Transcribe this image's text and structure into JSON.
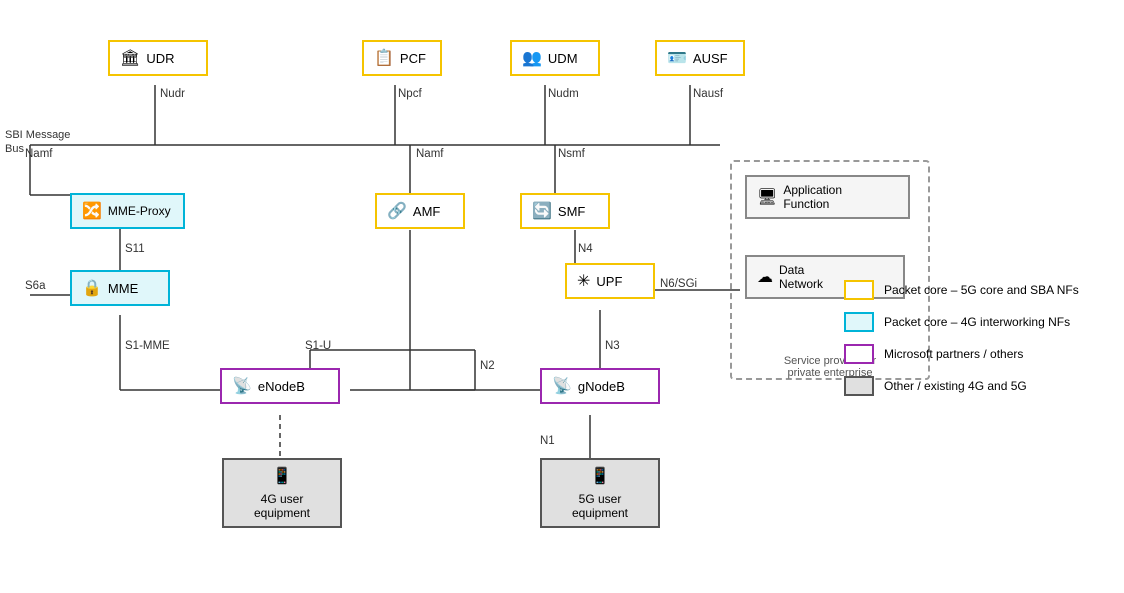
{
  "nodes": {
    "udr": {
      "label": "UDR",
      "type": "yellow",
      "icon": "🏛"
    },
    "pcf": {
      "label": "PCF",
      "type": "yellow",
      "icon": "📋"
    },
    "udm": {
      "label": "UDM",
      "type": "yellow",
      "icon": "👥"
    },
    "ausf": {
      "label": "AUSF",
      "type": "yellow",
      "icon": "🪪"
    },
    "mme_proxy": {
      "label": "MME-Proxy",
      "type": "cyan",
      "icon": "🔀"
    },
    "mme": {
      "label": "MME",
      "type": "cyan",
      "icon": "🔒"
    },
    "amf": {
      "label": "AMF",
      "type": "yellow",
      "icon": "🔗"
    },
    "smf": {
      "label": "SMF",
      "type": "yellow",
      "icon": "🔄"
    },
    "upf": {
      "label": "UPF",
      "type": "yellow",
      "icon": "✳"
    },
    "enodeb": {
      "label": "eNodeB",
      "type": "purple",
      "icon": "📡"
    },
    "gnodeb": {
      "label": "gNodeB",
      "type": "purple",
      "icon": "📡"
    },
    "ue_4g": {
      "label": "4G user\nequipment",
      "type": "dark",
      "icon": "📱"
    },
    "ue_5g": {
      "label": "5G user\nequipment",
      "type": "dark",
      "icon": "📱"
    },
    "af": {
      "label": "Application\nFunction",
      "type": "gray",
      "icon": "🖥"
    },
    "dn": {
      "label": "Data\nNetwork",
      "type": "gray",
      "icon": "☁"
    }
  },
  "interface_labels": {
    "nudr": "Nudr",
    "namf1": "Namf",
    "npcf": "Npcf",
    "namf2": "Namf",
    "nudm": "Nudm",
    "nsmf": "Nsmf",
    "nausf": "Nausf",
    "s11": "S11",
    "s6a": "S6a",
    "s1_mme": "S1-MME",
    "s1_u": "S1-U",
    "n4": "N4",
    "n6_sgi": "N6/SGi",
    "n3": "N3",
    "n2": "N2",
    "n1": "N1",
    "sbi": "SBI Message\nBus"
  },
  "dashed_region": {
    "label": "Service provider or\nprivate enterprise"
  },
  "legend": {
    "items": [
      {
        "label": "Packet core – 5G core and SBA NFs",
        "color": "#F5C400",
        "bg": "#fff"
      },
      {
        "label": "Packet core – 4G interworking NFs",
        "color": "#00B4D8",
        "bg": "#E0F7FA"
      },
      {
        "label": "Microsoft partners / others",
        "color": "#9B27AF",
        "bg": "#fff"
      },
      {
        "label": "Other / existing 4G and 5G",
        "color": "#555",
        "bg": "#e0e0e0"
      }
    ]
  }
}
